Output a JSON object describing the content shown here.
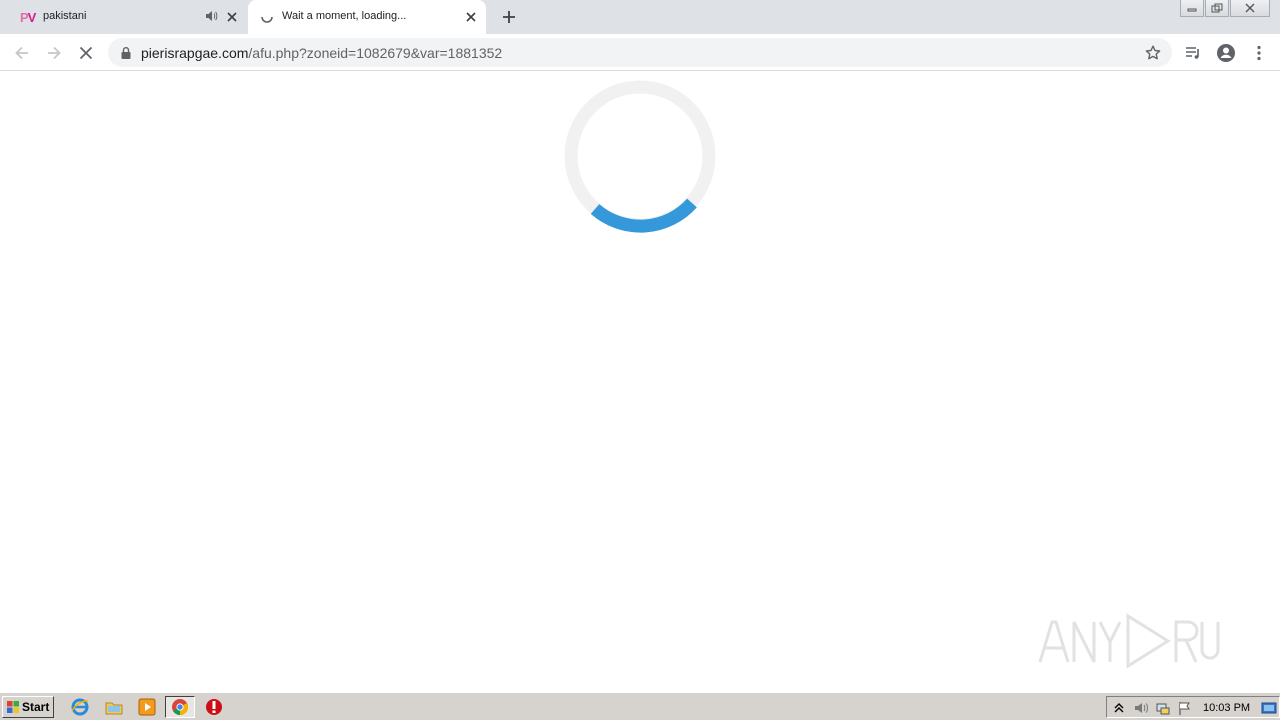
{
  "browser": {
    "tabs": [
      {
        "title": "pakistani",
        "favicon": "PV",
        "audio": true,
        "active": false
      },
      {
        "title": "Wait a moment, loading...",
        "loading": true,
        "active": true
      }
    ],
    "url_host": "pierisrapgae.com",
    "url_path": "/afu.php?zoneid=1082679&var=1881352"
  },
  "page": {
    "loader_accent": "#3498db",
    "loader_track": "#f1f1f1",
    "watermark": "ANY RUN"
  },
  "taskbar": {
    "start_label": "Start",
    "clock": "10:03 PM"
  }
}
